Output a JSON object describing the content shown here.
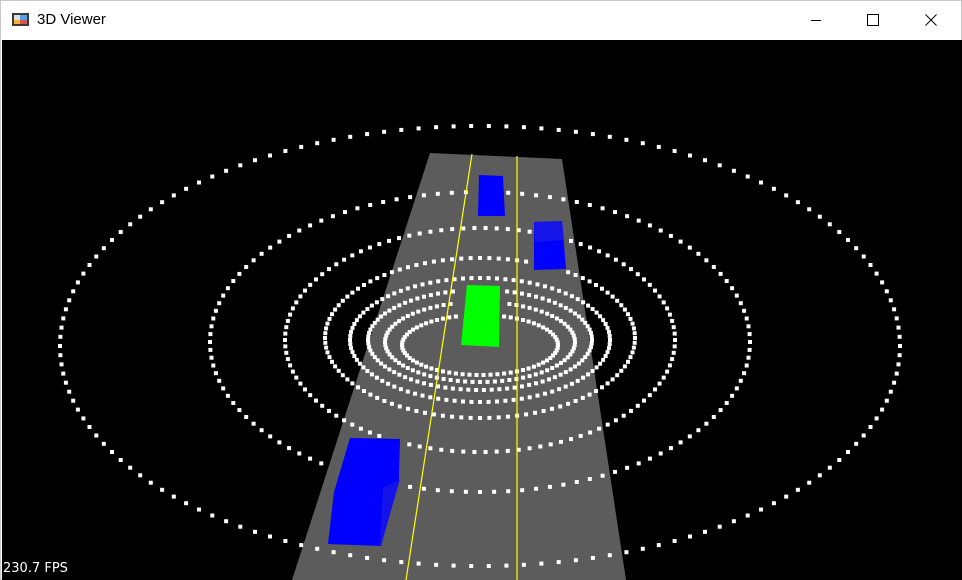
{
  "window": {
    "title": "3D Viewer",
    "icon": "app-3d-icon",
    "controls": {
      "minimize_icon": "minimize-icon",
      "maximize_icon": "maximize-icon",
      "close_icon": "close-icon"
    }
  },
  "viewport": {
    "fps_label": "230.7 FPS",
    "background_color": "#000000",
    "road_color": "#5c5c5c",
    "lane_line_color": "#ffff00",
    "ego_vehicle_color": "#00ff00",
    "other_vehicle_color": "#0000ff",
    "lidar_point_color": "#ffffff",
    "vehicles": [
      {
        "name": "ego-vehicle",
        "color_role": "ego"
      },
      {
        "name": "vehicle-far",
        "color_role": "other"
      },
      {
        "name": "vehicle-right",
        "color_role": "other"
      },
      {
        "name": "vehicle-near-left",
        "color_role": "other"
      }
    ]
  }
}
